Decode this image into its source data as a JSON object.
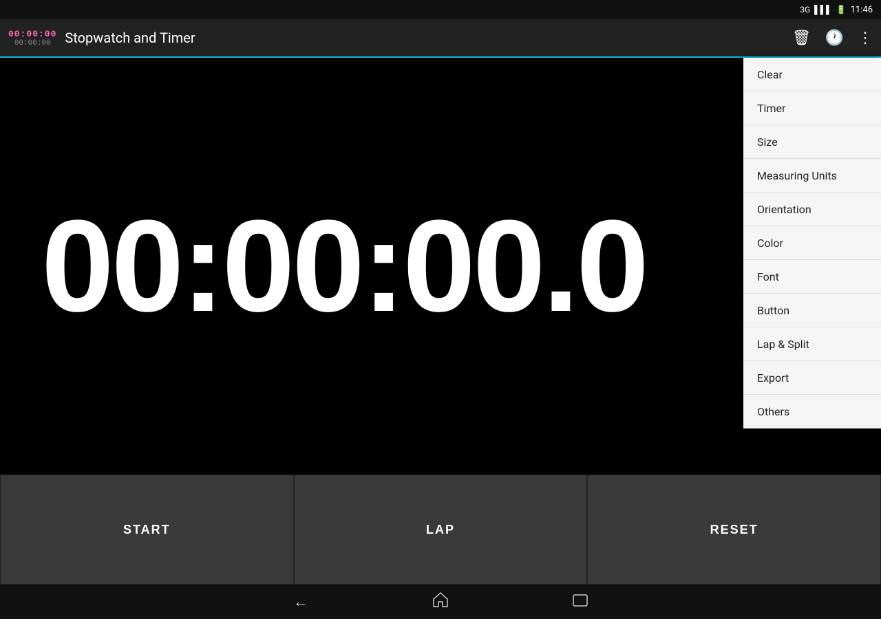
{
  "statusBar": {
    "network": "3G",
    "time": "11:46"
  },
  "titleBar": {
    "appTitle": "Stopwatch and Timer",
    "smallDisplay1": "00:00:00",
    "smallDisplay2": "00:00:00"
  },
  "timerDisplay": {
    "value": "00:00:00.0"
  },
  "bottomButtons": {
    "start": "START",
    "lap": "LAP",
    "reset": "RESET"
  },
  "dropdownMenu": {
    "items": [
      {
        "id": "clear",
        "label": "Clear"
      },
      {
        "id": "timer",
        "label": "Timer"
      },
      {
        "id": "size",
        "label": "Size"
      },
      {
        "id": "measuring-units",
        "label": "Measuring Units"
      },
      {
        "id": "orientation",
        "label": "Orientation"
      },
      {
        "id": "color",
        "label": "Color"
      },
      {
        "id": "font",
        "label": "Font"
      },
      {
        "id": "button",
        "label": "Button"
      },
      {
        "id": "lap-split",
        "label": "Lap & Split"
      },
      {
        "id": "export",
        "label": "Export"
      },
      {
        "id": "others",
        "label": "Others"
      }
    ]
  },
  "navBar": {
    "back": "←",
    "home": "⌂",
    "recents": "▭"
  }
}
